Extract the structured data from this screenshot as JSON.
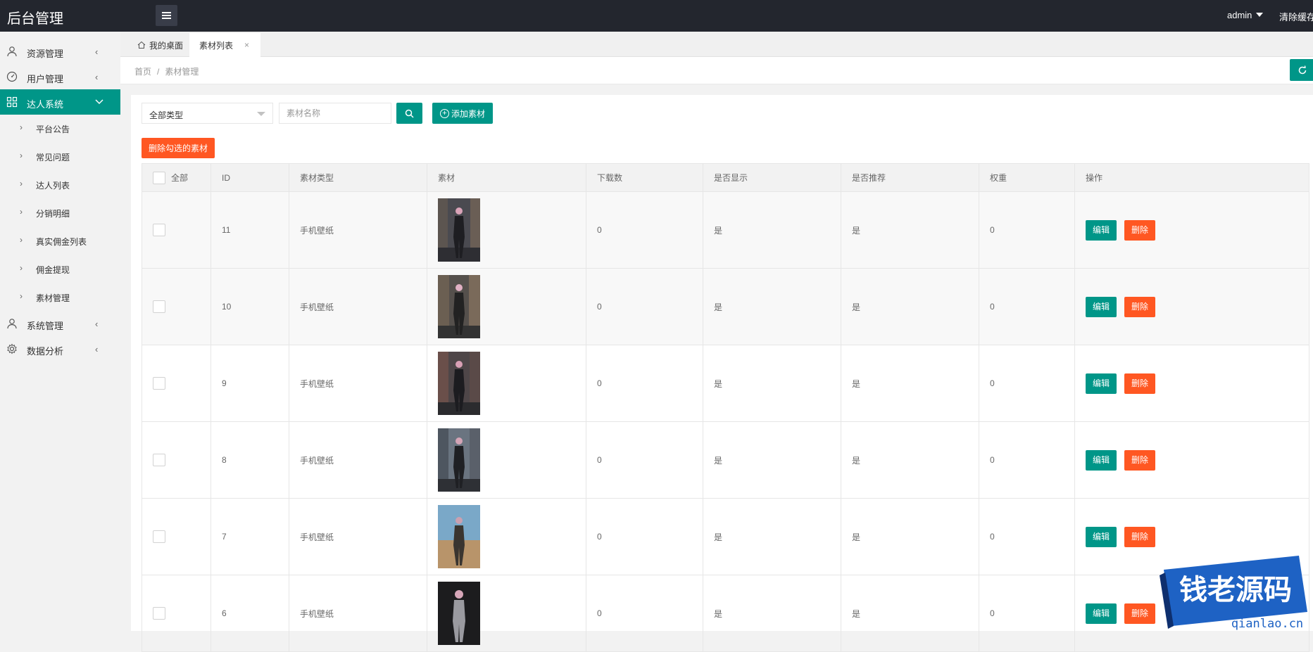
{
  "header": {
    "title": "后台管理",
    "user": "admin",
    "clear_cache": "清除缓存"
  },
  "sidebar": {
    "items": [
      {
        "label": "资源管理",
        "icon": "user-icon"
      },
      {
        "label": "用户管理",
        "icon": "gauge-icon"
      },
      {
        "label": "达人系统",
        "icon": "grid-icon"
      },
      {
        "label": "系统管理",
        "icon": "user-icon"
      },
      {
        "label": "数据分析",
        "icon": "gear-icon"
      }
    ],
    "sub_items": [
      "平台公告",
      "常见问题",
      "达人列表",
      "分销明细",
      "真实佣金列表",
      "佣金提现",
      "素材管理"
    ]
  },
  "tabs": [
    {
      "label": "我的桌面"
    },
    {
      "label": "素材列表"
    }
  ],
  "breadcrumb": {
    "home": "首页",
    "sep": "/",
    "current": "素材管理"
  },
  "filters": {
    "type_select": "全部类型",
    "name_placeholder": "素材名称",
    "add_label": "添加素材",
    "delete_selected_label": "删除勾选的素材"
  },
  "table": {
    "columns": [
      "全部",
      "ID",
      "素材类型",
      "素材",
      "下载数",
      "是否显示",
      "是否推荐",
      "权重",
      "操作"
    ],
    "rows": [
      {
        "id": "11",
        "type": "手机壁纸",
        "downloads": "0",
        "show": "是",
        "recommend": "是",
        "weight": "0"
      },
      {
        "id": "10",
        "type": "手机壁纸",
        "downloads": "0",
        "show": "是",
        "recommend": "是",
        "weight": "0"
      },
      {
        "id": "9",
        "type": "手机壁纸",
        "downloads": "0",
        "show": "是",
        "recommend": "是",
        "weight": "0"
      },
      {
        "id": "8",
        "type": "手机壁纸",
        "downloads": "0",
        "show": "是",
        "recommend": "是",
        "weight": "0"
      },
      {
        "id": "7",
        "type": "手机壁纸",
        "downloads": "0",
        "show": "是",
        "recommend": "是",
        "weight": "0"
      },
      {
        "id": "6",
        "type": "手机壁纸",
        "downloads": "0",
        "show": "是",
        "recommend": "是",
        "weight": "0"
      }
    ],
    "edit_label": "编辑",
    "delete_label": "删除"
  },
  "watermark": {
    "title": "钱老源码",
    "url": "qianlao.cn"
  },
  "colors": {
    "header_bg": "#23262e",
    "accent": "#009688",
    "danger": "#ff5722"
  }
}
